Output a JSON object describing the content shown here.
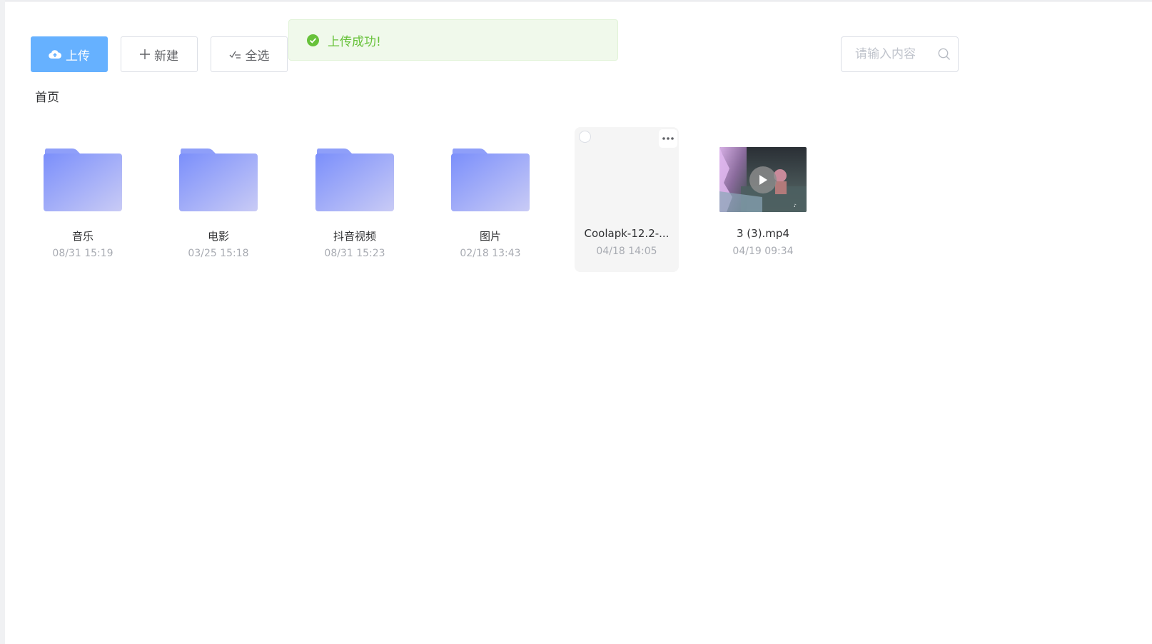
{
  "toolbar": {
    "upload_label": "上传",
    "new_label": "新建",
    "select_all_label": "全选"
  },
  "toast": {
    "message": "上传成功!",
    "color": "#67c23a"
  },
  "search": {
    "placeholder": "请输入内容"
  },
  "breadcrumb": {
    "current": "首页"
  },
  "items": [
    {
      "name": "音乐",
      "date": "08/31 15:19",
      "type": "folder",
      "icon": "folder-icon"
    },
    {
      "name": "电影",
      "date": "03/25 15:18",
      "type": "folder",
      "icon": "folder-icon"
    },
    {
      "name": "抖音视频",
      "date": "08/31 15:23",
      "type": "folder",
      "icon": "folder-icon"
    },
    {
      "name": "图片",
      "date": "02/18 13:43",
      "type": "folder",
      "icon": "folder-icon"
    },
    {
      "name": "Coolapk-12.2-...",
      "date": "04/18 14:05",
      "type": "file",
      "icon": "apk-file"
    },
    {
      "name": "3 (3).mp4",
      "date": "04/19 09:34",
      "type": "video",
      "icon": "video-thumbnail"
    }
  ],
  "colors": {
    "primary": "#66b1ff",
    "folder_start": "#7b8ffb",
    "folder_end": "#c9cbf5"
  }
}
